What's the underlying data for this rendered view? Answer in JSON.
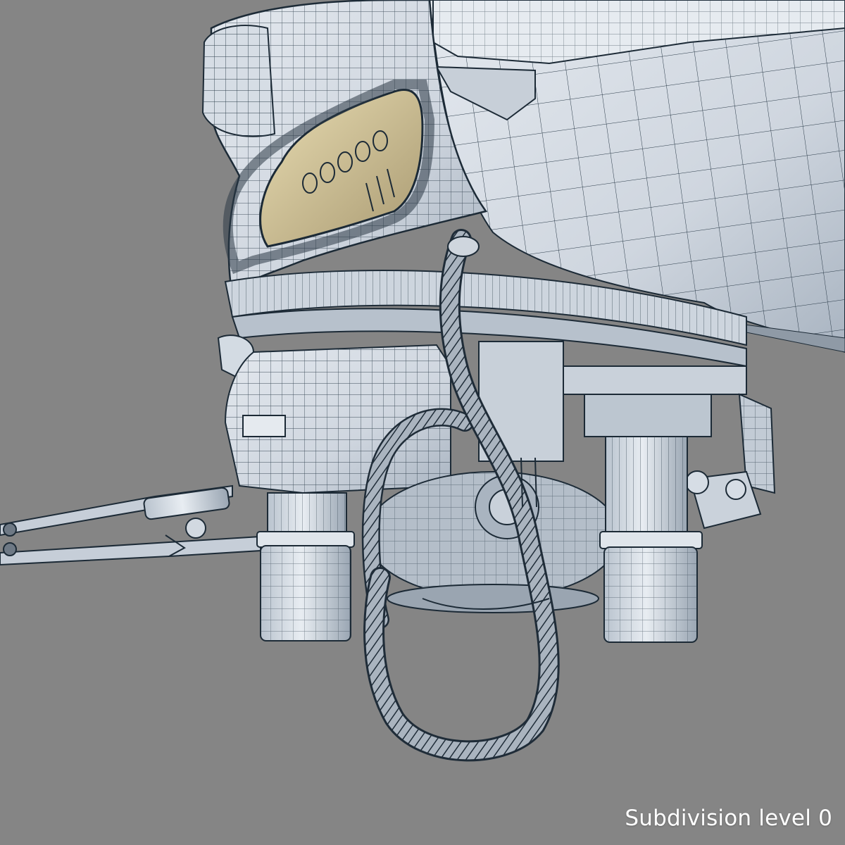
{
  "caption": "Subdivision level 0",
  "colors": {
    "background": "#858585",
    "surface": "#dbe2ea",
    "surface_dark": "#9fabb8",
    "wire": "#1c2a36",
    "interior": "#c9b98a"
  }
}
